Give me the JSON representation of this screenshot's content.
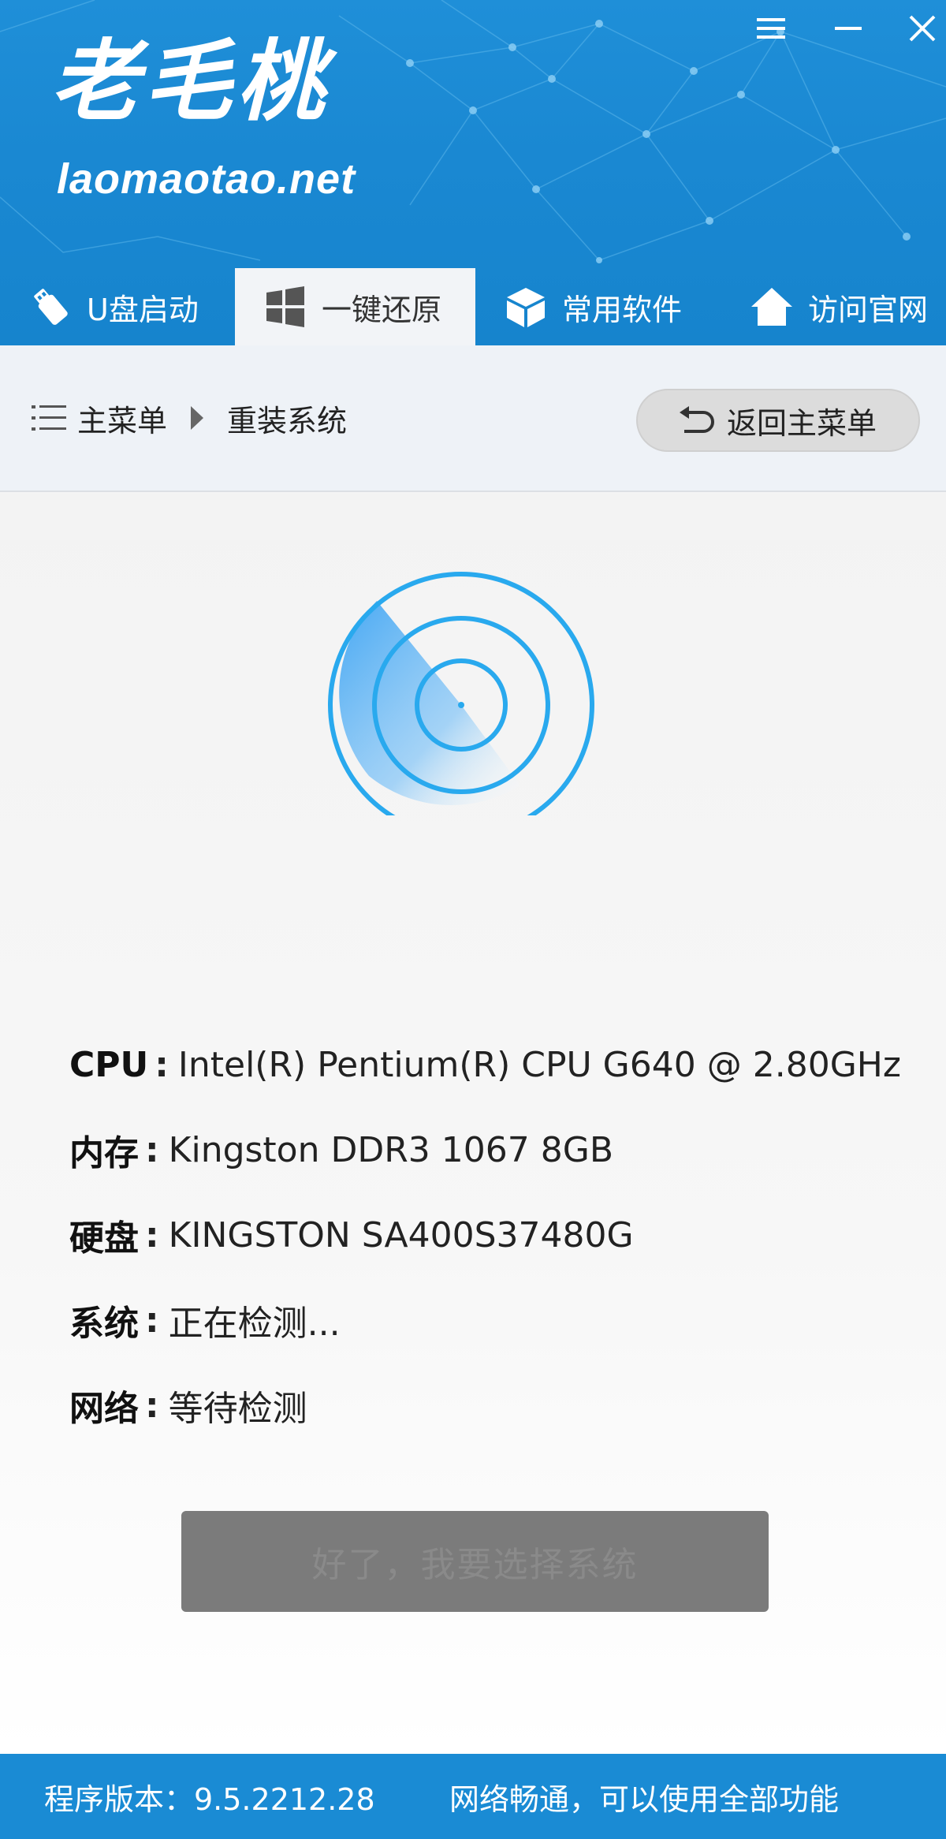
{
  "app": {
    "logo_text": "老毛桃",
    "logo_url": "laomaotao.net"
  },
  "window_controls": {
    "menu_icon": "menu-icon",
    "minimize_icon": "minimize-icon",
    "close_icon": "close-icon"
  },
  "tabs": [
    {
      "label": "U盘启动",
      "icon": "usb-icon",
      "active": false
    },
    {
      "label": "一键还原",
      "icon": "windows-icon",
      "active": true
    },
    {
      "label": "常用软件",
      "icon": "box-icon",
      "active": false
    },
    {
      "label": "访问官网",
      "icon": "home-icon",
      "active": false
    }
  ],
  "breadcrumb": {
    "root": "主菜单",
    "current": "重装系统"
  },
  "back_button": {
    "label": "返回主菜单"
  },
  "system_info": [
    {
      "label": "CPU",
      "value": "Intel(R) Pentium(R) CPU G640 @ 2.80GHz"
    },
    {
      "label": "内存",
      "value": "Kingston DDR3 1067 8GB"
    },
    {
      "label": "硬盘",
      "value": "KINGSTON SA400S37480G"
    },
    {
      "label": "系统",
      "value": "正在检测..."
    },
    {
      "label": "网络",
      "value": "等待检测"
    }
  ],
  "choose_button": {
    "label": "好了，我要选择系统"
  },
  "footer": {
    "version": "程序版本：9.5.2212.28",
    "network_status": "网络畅通，可以使用全部功能"
  },
  "colors": {
    "header_blue": "#1a88d2",
    "footer_blue": "#1a8bd4",
    "radar_blue": "#2aa7ef",
    "button_disabled": "#7b7b7b"
  }
}
